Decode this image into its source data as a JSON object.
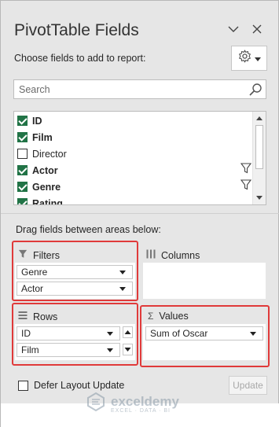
{
  "pane": {
    "title": "PivotTable Fields",
    "choose_text": "Choose fields to add to report:",
    "search_placeholder": "Search"
  },
  "fields": [
    {
      "label": "ID",
      "checked": true,
      "bold": true,
      "filter": false
    },
    {
      "label": "Film",
      "checked": true,
      "bold": true,
      "filter": false
    },
    {
      "label": "Director",
      "checked": false,
      "bold": false,
      "filter": false
    },
    {
      "label": "Actor",
      "checked": true,
      "bold": true,
      "filter": true
    },
    {
      "label": "Genre",
      "checked": true,
      "bold": true,
      "filter": true
    },
    {
      "label": "Rating",
      "checked": true,
      "bold": true,
      "filter": false
    }
  ],
  "drag_text": "Drag fields between areas below:",
  "areas": {
    "filters": {
      "title": "Filters",
      "items": [
        "Genre",
        "Actor"
      ]
    },
    "columns": {
      "title": "Columns",
      "items": []
    },
    "rows": {
      "title": "Rows",
      "items": [
        "ID",
        "Film"
      ]
    },
    "values": {
      "title": "Values",
      "items": [
        "Sum of Oscar"
      ]
    }
  },
  "defer_label": "Defer Layout Update",
  "update_label": "Update",
  "watermark": {
    "name": "exceldemy",
    "sub": "EXCEL · DATA · BI"
  },
  "colors": {
    "check": "#217346",
    "highlight": "#e03a3a"
  },
  "icons": [
    "chevron-down-icon",
    "close-icon",
    "gear-icon",
    "search-icon",
    "filter-icon",
    "rows-icon",
    "columns-icon",
    "sigma-icon"
  ]
}
